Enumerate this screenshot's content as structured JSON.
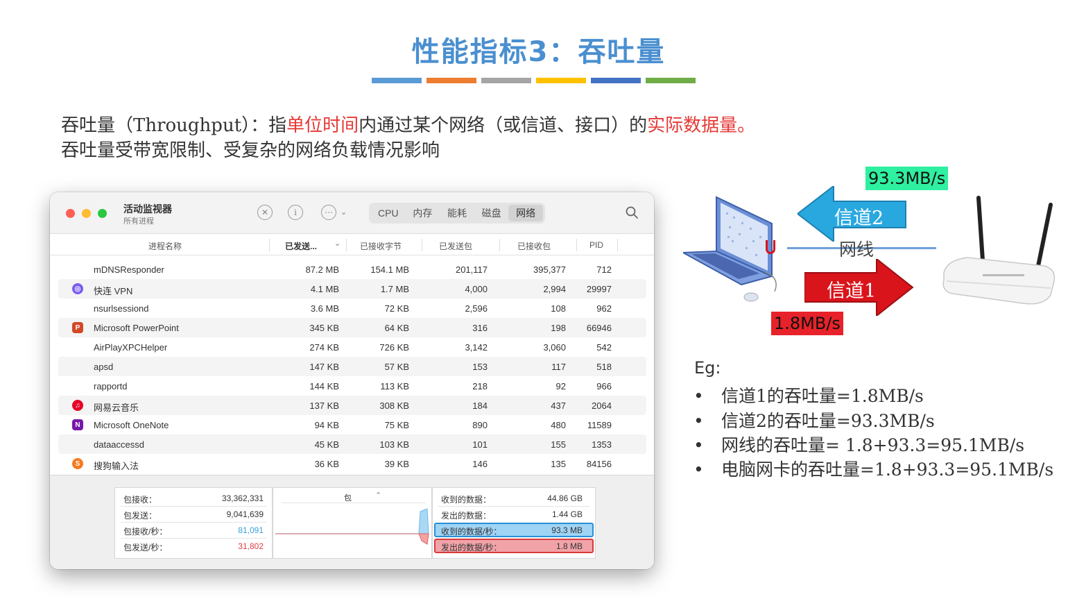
{
  "slide": {
    "title": "性能指标3：吞吐量",
    "color_bar": [
      "#5b9bd5",
      "#ed7d31",
      "#a5a5a5",
      "#ffc000",
      "#4472c4",
      "#70ad47"
    ],
    "line1": {
      "p1": "吞吐量（Throughput）：指",
      "p2": "单位时间",
      "p3": "内通过某个网络（或信道、接口）的",
      "p4": "实际数据量。"
    },
    "line2": "吞吐量受带宽限制、受复杂的网络负载情况影响"
  },
  "window": {
    "title": "活动监视器",
    "subtitle": "所有进程",
    "toolbar": {
      "stop_icon": "✕",
      "info_icon": "i",
      "more_icon": "⋯",
      "tabs": [
        {
          "label": "CPU",
          "active": false
        },
        {
          "label": "内存",
          "active": false
        },
        {
          "label": "能耗",
          "active": false
        },
        {
          "label": "磁盘",
          "active": false
        },
        {
          "label": "网络",
          "active": true
        }
      ]
    },
    "columns": [
      "进程名称",
      "已发送...",
      "已接收字节",
      "已发送包",
      "已接收包",
      "PID"
    ],
    "rows": [
      {
        "name": "mDNSResponder",
        "sent": "87.2 MB",
        "recv": "154.1 MB",
        "sent_pk": "201,117",
        "recv_pk": "395,377",
        "pid": "712",
        "icon": ""
      },
      {
        "name": "快连 VPN",
        "sent": "4.1 MB",
        "recv": "1.7 MB",
        "sent_pk": "4,000",
        "recv_pk": "2,994",
        "pid": "29997",
        "icon": "vpn"
      },
      {
        "name": "nsurlsessiond",
        "sent": "3.6 MB",
        "recv": "72 KB",
        "sent_pk": "2,596",
        "recv_pk": "108",
        "pid": "962",
        "icon": ""
      },
      {
        "name": "Microsoft PowerPoint",
        "sent": "345 KB",
        "recv": "64 KB",
        "sent_pk": "316",
        "recv_pk": "198",
        "pid": "66946",
        "icon": "ppt"
      },
      {
        "name": "AirPlayXPCHelper",
        "sent": "274 KB",
        "recv": "726 KB",
        "sent_pk": "3,142",
        "recv_pk": "3,060",
        "pid": "542",
        "icon": ""
      },
      {
        "name": "apsd",
        "sent": "147 KB",
        "recv": "57 KB",
        "sent_pk": "153",
        "recv_pk": "117",
        "pid": "518",
        "icon": ""
      },
      {
        "name": "rapportd",
        "sent": "144 KB",
        "recv": "113 KB",
        "sent_pk": "218",
        "recv_pk": "92",
        "pid": "966",
        "icon": ""
      },
      {
        "name": "网易云音乐",
        "sent": "137 KB",
        "recv": "308 KB",
        "sent_pk": "184",
        "recv_pk": "437",
        "pid": "2064",
        "icon": "music"
      },
      {
        "name": "Microsoft OneNote",
        "sent": "94 KB",
        "recv": "75 KB",
        "sent_pk": "890",
        "recv_pk": "480",
        "pid": "11589",
        "icon": "onenote"
      },
      {
        "name": "dataaccessd",
        "sent": "45 KB",
        "recv": "103 KB",
        "sent_pk": "101",
        "recv_pk": "155",
        "pid": "1353",
        "icon": ""
      },
      {
        "name": "搜狗输入法",
        "sent": "36 KB",
        "recv": "39 KB",
        "sent_pk": "146",
        "recv_pk": "135",
        "pid": "84156",
        "icon": "sogou"
      }
    ],
    "footer": {
      "left": [
        {
          "label": "包接收：",
          "value": "33,362,331",
          "color": "#333333"
        },
        {
          "label": "包发送：",
          "value": "9,041,639",
          "color": "#333333"
        },
        {
          "label": "包接收/秒：",
          "value": "81,091",
          "color": "#3aa0d8"
        },
        {
          "label": "包发送/秒：",
          "value": "31,802",
          "color": "#e04040"
        }
      ],
      "mid_selector": "包",
      "right": [
        {
          "label": "收到的数据：",
          "value": "44.86 GB"
        },
        {
          "label": "发出的数据：",
          "value": "1.44 GB"
        },
        {
          "label": "收到的数据/秒：",
          "value": "93.3 MB"
        },
        {
          "label": "发出的数据/秒：",
          "value": "1.8 MB"
        }
      ]
    }
  },
  "diagram": {
    "top_rate": "93.3MB/s",
    "bottom_rate": "1.8MB/s",
    "channel2": "信道2",
    "channel1": "信道1",
    "wire": "网线",
    "colors": {
      "channel2": "#29a8e0",
      "channel1": "#d9141b",
      "rate_top_bg": "#2ef0a0",
      "rate_bottom_bg": "#e8222a"
    }
  },
  "examples": {
    "title": "Eg:",
    "items": [
      "信道1的吞吐量=1.8MB/s",
      "信道2的吞吐量=93.3MB/s",
      "网线的吞吐量= 1.8+93.3=95.1MB/s",
      "电脑网卡的吞吐量=1.8+93.3=95.1MB/s"
    ]
  }
}
